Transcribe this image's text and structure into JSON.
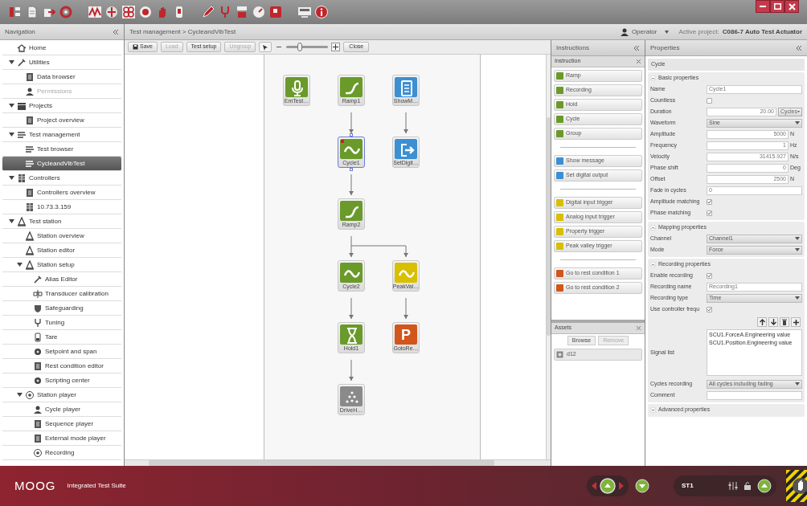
{
  "breadcrumb": "Test management > CycleandVibTest",
  "user": {
    "name": "Operator"
  },
  "project": {
    "label": "Active project:",
    "name": "C086-7 Auto Test Actuator"
  },
  "navigation": {
    "title": "Navigation",
    "items": [
      {
        "label": "Home",
        "kind": "home",
        "selected": false
      },
      {
        "label": "Utilities",
        "kind": "tool",
        "selected": false,
        "expanded": true,
        "children": [
          {
            "label": "Data browser",
            "kind": "data",
            "selected": false
          },
          {
            "label": "Permissions",
            "kind": "user",
            "selected": false,
            "disabled": true
          }
        ]
      },
      {
        "label": "Projects",
        "kind": "folder",
        "selected": false,
        "expanded": true,
        "children": [
          {
            "label": "Project overview",
            "kind": "data",
            "selected": false
          }
        ]
      },
      {
        "label": "Test management",
        "kind": "list",
        "selected": false,
        "expanded": true,
        "children": [
          {
            "label": "Test browser",
            "kind": "list",
            "selected": false
          },
          {
            "label": "CycleandVibTest",
            "kind": "list",
            "selected": true
          }
        ]
      },
      {
        "label": "Controllers",
        "kind": "grid",
        "selected": false,
        "expanded": true,
        "children": [
          {
            "label": "Controllers overview",
            "kind": "data",
            "selected": false
          },
          {
            "label": "10.73.3.159",
            "kind": "grid",
            "selected": false
          }
        ]
      },
      {
        "label": "Test station",
        "kind": "station",
        "selected": false,
        "expanded": true,
        "children": [
          {
            "label": "Station overview",
            "kind": "station",
            "selected": false
          },
          {
            "label": "Station editor",
            "kind": "station",
            "selected": false
          },
          {
            "label": "Station setup",
            "kind": "station",
            "selected": false,
            "expanded": true,
            "children": [
              {
                "label": "Alias Editor",
                "kind": "tool",
                "selected": false
              },
              {
                "label": "Transducer calibration",
                "kind": "scale",
                "selected": false
              },
              {
                "label": "Safeguarding",
                "kind": "shield",
                "selected": false
              },
              {
                "label": "Tuning",
                "kind": "fork",
                "selected": false
              },
              {
                "label": "Tare",
                "kind": "cup",
                "selected": false
              },
              {
                "label": "Setpoint and span",
                "kind": "gear",
                "selected": false
              },
              {
                "label": "Rest condition editor",
                "kind": "data",
                "selected": false
              },
              {
                "label": "Scripting center",
                "kind": "gear",
                "selected": false
              }
            ]
          },
          {
            "label": "Station player",
            "kind": "play",
            "selected": false,
            "expanded": true,
            "children": [
              {
                "label": "Cycle player",
                "kind": "user",
                "selected": false
              },
              {
                "label": "Sequence player",
                "kind": "data",
                "selected": false
              },
              {
                "label": "External mode player",
                "kind": "data",
                "selected": false
              },
              {
                "label": "Recording",
                "kind": "play",
                "selected": false
              }
            ]
          }
        ]
      }
    ]
  },
  "editor_toolbar": {
    "buttons": [
      {
        "label": "Save",
        "kind": "icon",
        "disabled": false
      },
      {
        "label": "Load",
        "kind": "plain",
        "disabled": true
      },
      {
        "label": "Test setup",
        "kind": "plain",
        "disabled": false
      },
      {
        "label": "Ungroup",
        "kind": "plain",
        "disabled": true
      }
    ],
    "zoom": {
      "level": 0.3
    },
    "close": "Close"
  },
  "diagram": {
    "rows": [
      [
        {
          "label": "EmTest…",
          "kind": "microphone",
          "color": "#6a9a2a",
          "selected": false,
          "flagged": false
        },
        {
          "label": "Ramp1",
          "kind": "ramp",
          "color": "#6a9a2a",
          "selected": false,
          "flagged": false
        },
        {
          "label": "ShowM…",
          "kind": "document",
          "color": "#3c8fd2",
          "selected": false,
          "flagged": false
        }
      ],
      [
        null,
        {
          "label": "Cycle1",
          "kind": "sine",
          "color": "#6a9a2a",
          "selected": true,
          "flagged": true
        },
        {
          "label": "SetDigit…",
          "kind": "export",
          "color": "#3c8fd2",
          "selected": false,
          "flagged": false
        }
      ],
      [
        null,
        {
          "label": "Ramp2",
          "kind": "ramp",
          "color": "#6a9a2a",
          "selected": false,
          "flagged": false
        },
        null
      ],
      [
        null,
        {
          "label": "Cycle2",
          "kind": "sine",
          "color": "#6a9a2a",
          "selected": false,
          "flagged": false
        },
        {
          "label": "PeakVal…",
          "kind": "sine",
          "color": "#d8bf00",
          "selected": false,
          "flagged": false
        }
      ],
      [
        null,
        {
          "label": "Hold1",
          "kind": "hourglass",
          "color": "#6a9a2a",
          "selected": false,
          "flagged": false
        },
        {
          "label": "GotoRe…",
          "kind": "letter",
          "glyph": "P",
          "color": "#d2561c",
          "selected": false,
          "flagged": false
        }
      ],
      [
        null,
        {
          "label": "DriveH…",
          "kind": "dots",
          "color": "#8a8a8a",
          "selected": false,
          "flagged": false
        },
        null
      ]
    ]
  },
  "instructions": {
    "title": "Instructions",
    "subtitle": "Instruction",
    "items": [
      {
        "kind": "item",
        "label": "Ramp",
        "color": "#6a9a2a"
      },
      {
        "kind": "item",
        "label": "Recording",
        "color": "#6a9a2a"
      },
      {
        "kind": "item",
        "label": "Hold",
        "color": "#6a9a2a"
      },
      {
        "kind": "item",
        "label": "Cycle",
        "color": "#6a9a2a"
      },
      {
        "kind": "item",
        "label": "Group",
        "color": "#6a9a2a"
      },
      {
        "kind": "separator"
      },
      {
        "kind": "item",
        "label": "Show message",
        "color": "#3c8fd2"
      },
      {
        "kind": "item",
        "label": "Set digital output",
        "color": "#3c8fd2"
      },
      {
        "kind": "separator"
      },
      {
        "kind": "item",
        "label": "Digital input trigger",
        "color": "#d8bf00"
      },
      {
        "kind": "item",
        "label": "Analog input trigger",
        "color": "#d8bf00"
      },
      {
        "kind": "item",
        "label": "Property trigger",
        "color": "#d8bf00"
      },
      {
        "kind": "item",
        "label": "Peak valley trigger",
        "color": "#d8bf00"
      },
      {
        "kind": "separator"
      },
      {
        "kind": "item",
        "label": "Go to rest condition 1",
        "color": "#d2561c"
      },
      {
        "kind": "item",
        "label": "Go to rest condition 2",
        "color": "#d2561c"
      }
    ]
  },
  "assets": {
    "title": "Assets",
    "buttons": [
      {
        "label": "Browse",
        "disabled": false
      },
      {
        "label": "Remove",
        "disabled": true
      }
    ],
    "items": [
      "d12"
    ]
  },
  "properties": {
    "title": "Properties",
    "object": "Cycle",
    "sections": [
      {
        "title": "Basic properties",
        "expanded": true,
        "rows": [
          {
            "label": "Name",
            "kind": "text",
            "value": "Cycle1"
          },
          {
            "label": "Countless",
            "kind": "checkbox",
            "checked": false
          },
          {
            "label": "Duration",
            "kind": "number_select",
            "value": "20.00",
            "option": "Cycles"
          },
          {
            "label": "Waveform",
            "kind": "select",
            "value": "Sine"
          },
          {
            "label": "Amplitude",
            "kind": "number",
            "value": "5000",
            "unit": "N"
          },
          {
            "label": "Frequency",
            "kind": "number",
            "value": "1",
            "unit": "Hz"
          },
          {
            "label": "Velocity",
            "kind": "number",
            "value": "31415.927",
            "unit": "N/s"
          },
          {
            "label": "Phase shift",
            "kind": "number",
            "value": "0",
            "unit": "Deg"
          },
          {
            "label": "Offset",
            "kind": "number",
            "value": "2500",
            "unit": "N"
          },
          {
            "label": "Fade in cycles",
            "kind": "text",
            "value": "0"
          },
          {
            "label": "Amplitude matching",
            "kind": "checkbox",
            "checked": true
          },
          {
            "label": "Phase matching",
            "kind": "checkbox",
            "checked": true
          }
        ]
      },
      {
        "title": "Mapping properties",
        "expanded": true,
        "rows": [
          {
            "label": "Channel",
            "kind": "select",
            "value": "Channel1"
          },
          {
            "label": "Mode",
            "kind": "select",
            "value": "Force"
          }
        ]
      },
      {
        "title": "Recording properties",
        "expanded": true,
        "rows": [
          {
            "label": "Enable recording",
            "kind": "checkbox",
            "checked": true
          },
          {
            "label": "Recording name",
            "kind": "text",
            "value": "Recording1"
          },
          {
            "label": "Recording type",
            "kind": "select",
            "value": "Time"
          },
          {
            "label": "Use controller frequ",
            "kind": "checkbox",
            "checked": true
          },
          {
            "label": "Signal list",
            "kind": "list",
            "items": [
              "SCU1.ForceA.Engineering value",
              "SCU1.Position.Engineering value"
            ]
          },
          {
            "label": "Cycles recording",
            "kind": "select",
            "value": "All cycles including fading"
          },
          {
            "label": "Comment",
            "kind": "text"
          }
        ]
      },
      {
        "title": "Advanced properties",
        "expanded": false
      }
    ]
  },
  "footer": {
    "brand": "MOOG",
    "product": "Integrated Test Suite",
    "station": "ST1"
  }
}
